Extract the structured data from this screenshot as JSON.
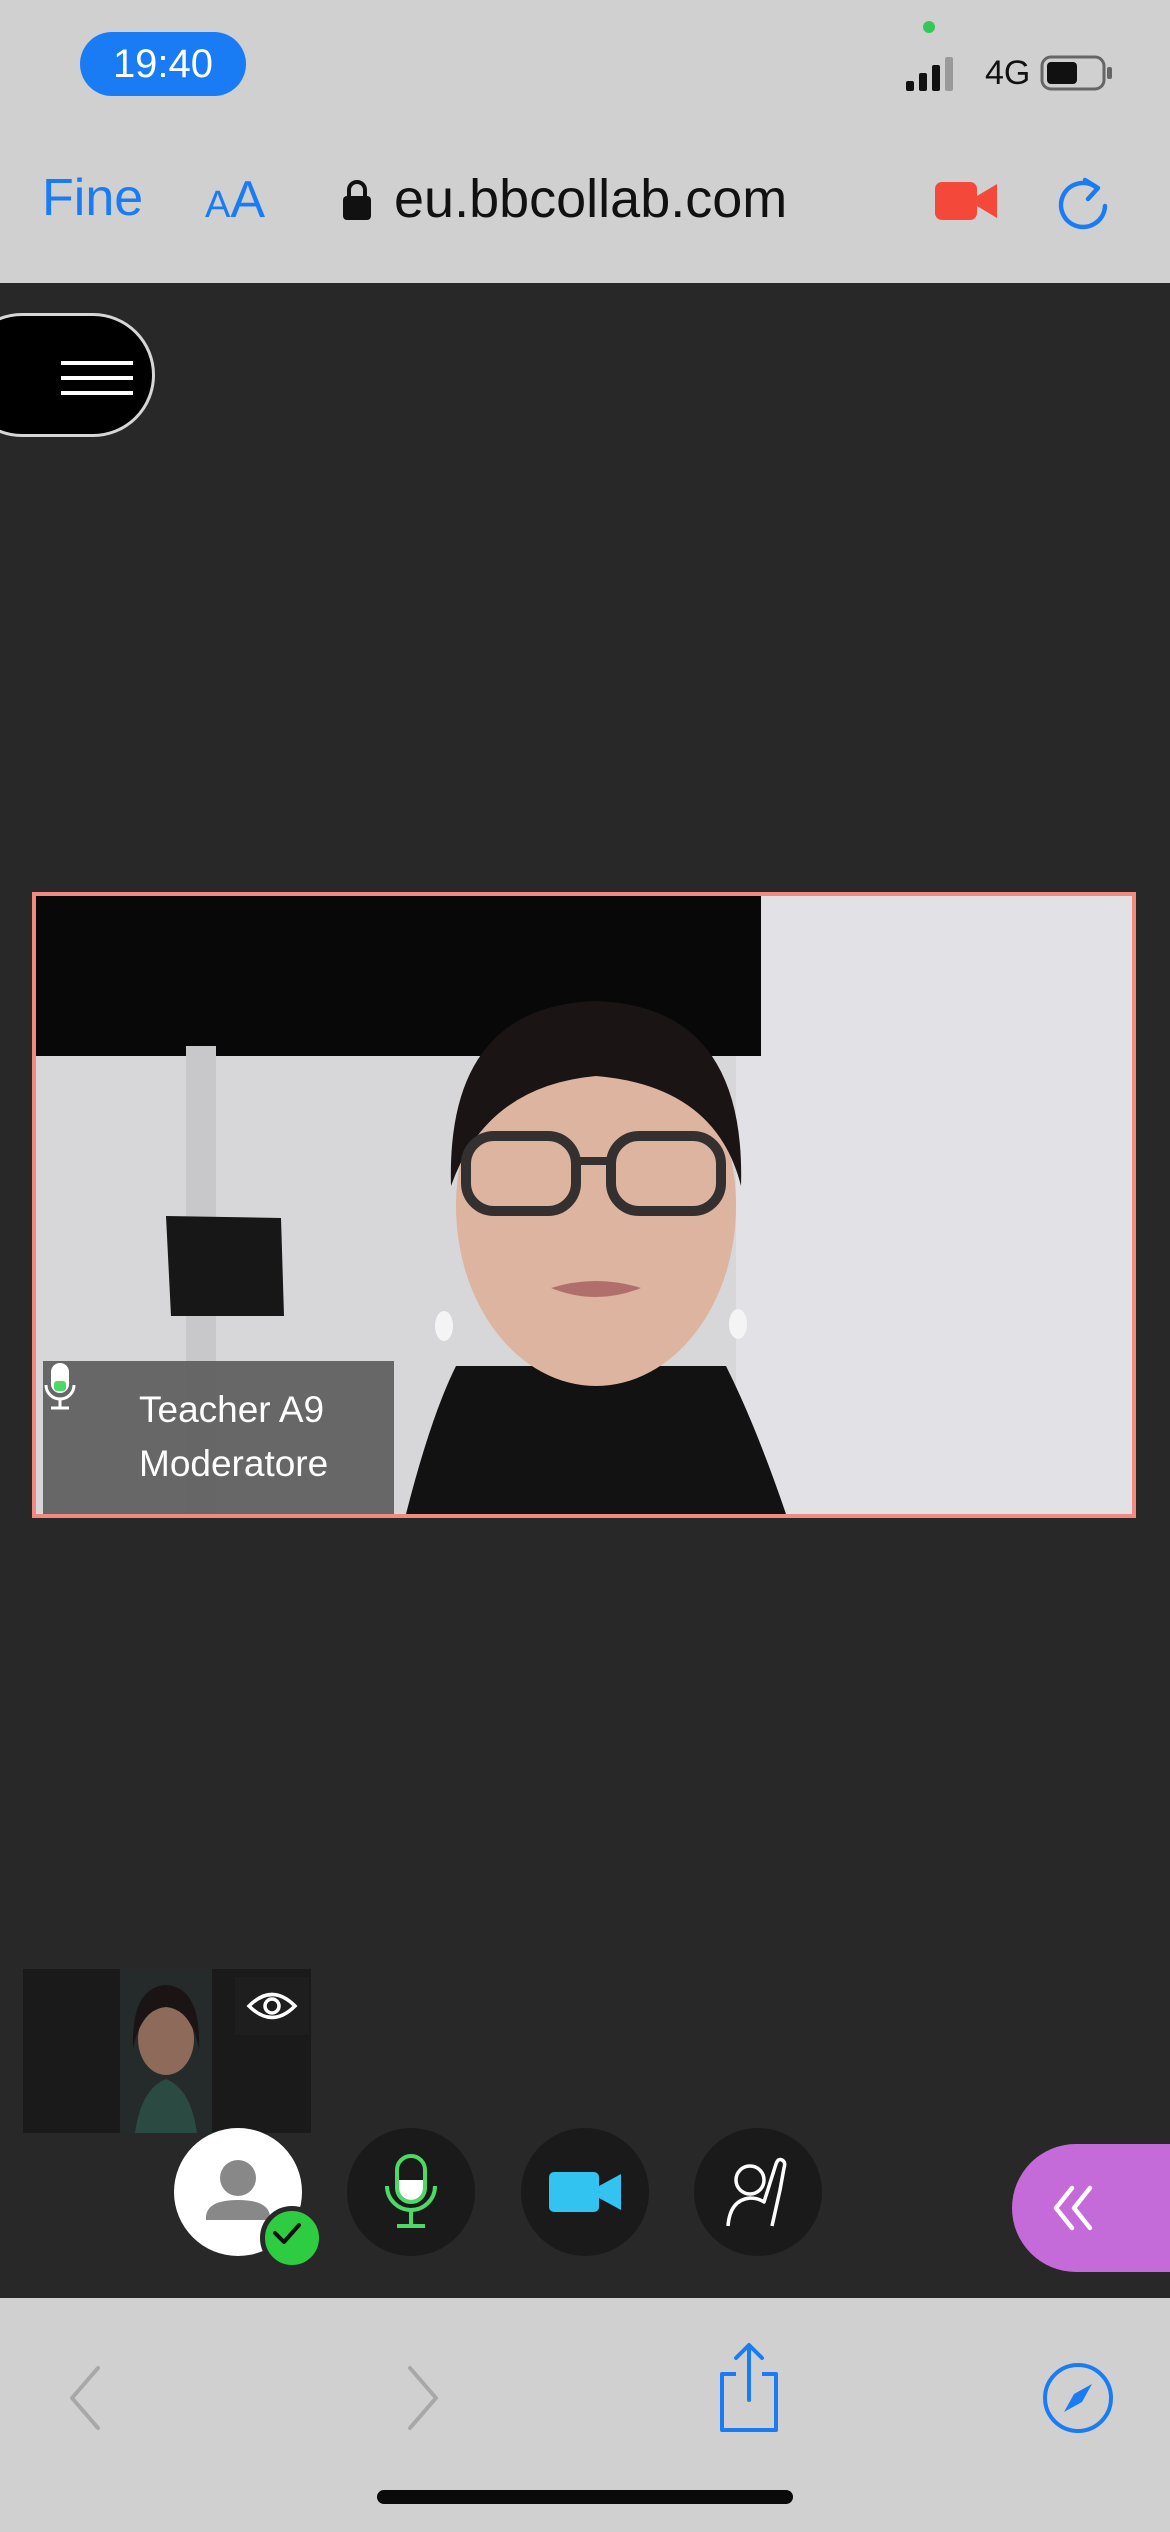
{
  "status_bar": {
    "time": "19:40",
    "network": "4G"
  },
  "safari": {
    "done_label": "Fine",
    "aa_small": "A",
    "aa_big": "A",
    "url": "eu.bbcollab.com",
    "accent_color": "#1a7cf5",
    "camera_indicator_color": "#f4493a"
  },
  "video_tile": {
    "participant_name": "Teacher A9",
    "participant_role": "Moderatore",
    "active_speaker_border_color": "#f28a7f"
  },
  "controls": {
    "status_check_color": "#2ecc40",
    "mic_color": "#4cd964",
    "camera_color": "#33c3f0",
    "collapse_panel_color": "#c56ad9"
  },
  "icons": [
    "lock-icon",
    "video-camera-icon",
    "reload-icon",
    "menu-icon",
    "microphone-icon",
    "eye-icon",
    "avatar-icon",
    "checkmark-icon",
    "raise-hand-icon",
    "double-chevron-left-icon",
    "back-icon",
    "forward-icon",
    "share-icon",
    "compass-icon"
  ]
}
